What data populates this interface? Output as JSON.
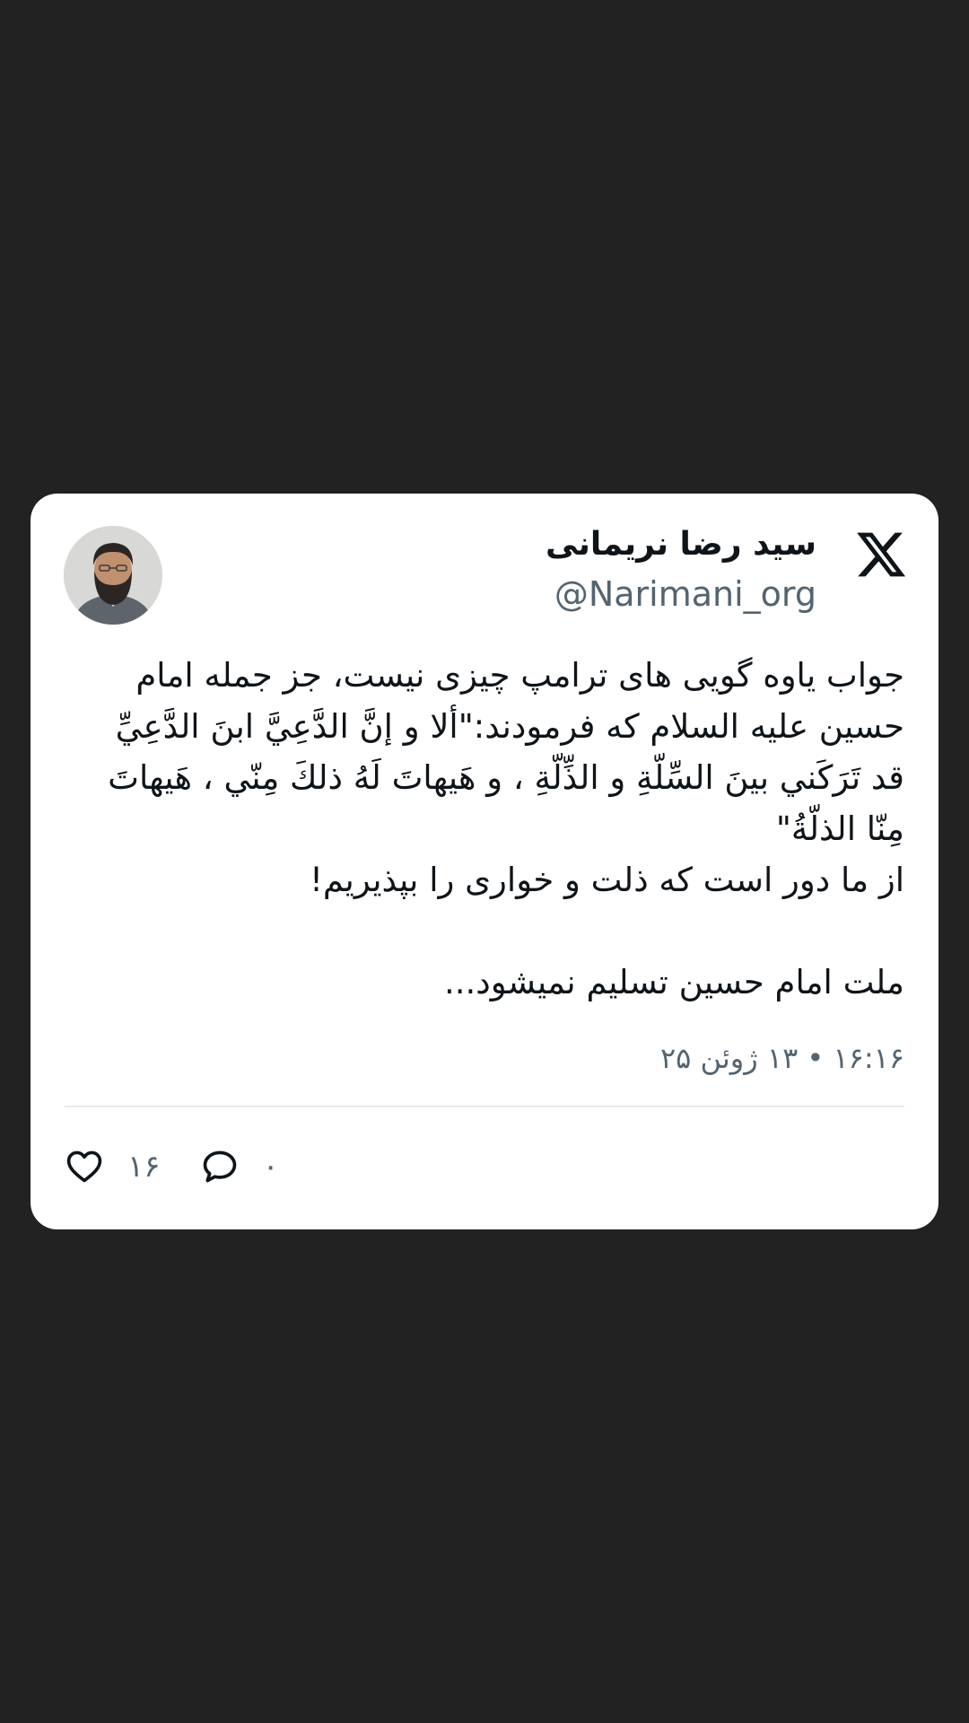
{
  "tweet": {
    "author_name": "سید رضا نریمانی",
    "handle": "@Narimani_org",
    "text_lines": [
      "جواب یاوه گویی های ترامپ چیزی نیست، جز جمله امام",
      "حسین علیه السلام که فرمودند:\"ألا و إنَّ الدَّعِيَّ ابنَ الدَّعِيِّ",
      "قد تَرَكَني بينَ السِّلّةِ و الذِّلّةِ ، و هَيهاتَ لَهُ ذلكَ مِنّي ، هَيهاتَ",
      "مِنّا الذلّةُ\"",
      "از ما دور است که ذلت و خواری را بپذیریم!",
      "",
      "ملت امام حسین تسلیم نمیشود..."
    ],
    "timestamp": "۱۶:۱۶ • ۱۳ ژوئن ۲۵",
    "likes": "۱۶",
    "replies": "۰"
  },
  "icons": {
    "platform": "x-logo-icon",
    "like": "heart-icon",
    "reply": "comment-icon"
  },
  "colors": {
    "background": "#222222",
    "card": "#ffffff",
    "text": "#0f1419",
    "secondary": "#536471"
  }
}
